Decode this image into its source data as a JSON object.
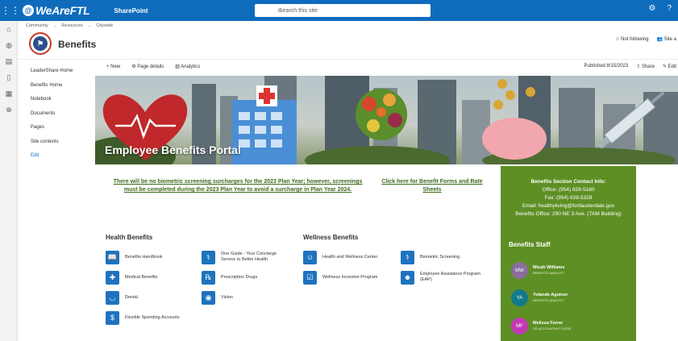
{
  "suitebar": {
    "brand": "WeAreFTL",
    "app_name": "SharePoint",
    "search_placeholder": "Search this site"
  },
  "hubnav": [
    "Community",
    "Resources",
    "Citywide"
  ],
  "site": {
    "title": "Benefits",
    "follow_label": "Not following",
    "share_label": "Site a"
  },
  "quicklaunch": [
    "LeaderShare Home",
    "Benefits Home",
    "Notebook",
    "Documents",
    "Pages",
    "Site contents",
    "Edit"
  ],
  "commandbar": {
    "new_label": "+ New",
    "page_details_label": "Page details",
    "analytics_label": "Analytics",
    "published": "Published 8/15/2023",
    "share": "Share",
    "edit": "Edit"
  },
  "hero": {
    "title": "Employee Benefits Portal"
  },
  "notice": "There will be no biometric screening surcharges for the 2023 Plan Year; however, screenings must be completed during the 2023 Plan Year to avoid a surcharge in Plan Year 2024.",
  "forms_link": "Click here for Benefit Forms and Rate Sheets",
  "health": {
    "heading": "Health Benefits",
    "items": [
      {
        "label": "Benefits Handbook",
        "icon": "book-icon"
      },
      {
        "label": "One Guide - Your Concierge Service to Better Health",
        "icon": "stethoscope-icon"
      },
      {
        "label": "Medical Benefits",
        "icon": "medical-icon"
      },
      {
        "label": "Prescription Drugs",
        "icon": "pill-icon"
      },
      {
        "label": "Dental",
        "icon": "tooth-icon"
      },
      {
        "label": "Vision",
        "icon": "eye-icon"
      },
      {
        "label": "Flexible Spending Accounts",
        "icon": "money-icon"
      }
    ]
  },
  "wellness": {
    "heading": "Wellness Benefits",
    "items": [
      {
        "label": "Health and Wellness Center",
        "icon": "doctor-icon"
      },
      {
        "label": "Biometric Screening",
        "icon": "stethoscope-icon"
      },
      {
        "label": "Wellness Incentive Program",
        "icon": "checklist-icon"
      },
      {
        "label": "Employee Assistance Program (EAP)",
        "icon": "person-icon"
      }
    ]
  },
  "contact": {
    "title": "Benefits Section Contact Info:",
    "office": "Office: (954) 828-5160",
    "fax": "Fax: (954) 828-5328",
    "email": "Email: healthyliving@fortlauderdale.gov",
    "address": "Benefits Office: 290 NE 3 Ave. (TAM Building)"
  },
  "staff": {
    "heading": "Benefits Staff",
    "members": [
      {
        "initials": "MW",
        "name": "Micah Williams",
        "role": "BENEFITS ANALYST",
        "color": "#8a6d9e"
      },
      {
        "initials": "YA",
        "name": "Yolande Aguinor",
        "role": "BENEFITS ANALYST",
        "color": "#117a8b"
      },
      {
        "initials": "MF",
        "name": "Melissa Ferrer",
        "role": "SR ACCOUNTING CLERK",
        "color": "#c239b3"
      }
    ]
  },
  "colors": {
    "suitebar": "#0f6cbd",
    "accent_green": "#5e8f25",
    "link_green": "#3d6b1a",
    "icon_blue": "#1e73be"
  }
}
